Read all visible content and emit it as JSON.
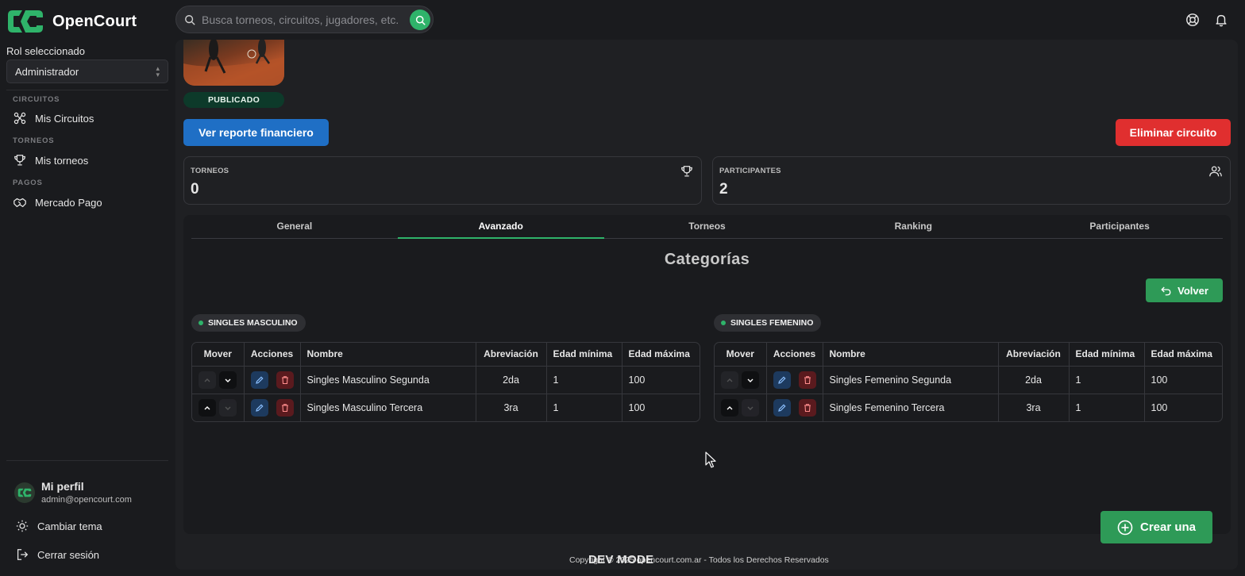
{
  "app": {
    "name": "OpenCourt"
  },
  "search": {
    "placeholder": "Busca torneos, circuitos, jugadores, etc."
  },
  "sidebar": {
    "rol_label": "Rol seleccionado",
    "rol_value": "Administrador",
    "sections": [
      {
        "title": "CIRCUITOS",
        "item": "Mis Circuitos",
        "icon": "circuit-icon"
      },
      {
        "title": "TORNEOS",
        "item": "Mis torneos",
        "icon": "trophy-icon"
      },
      {
        "title": "PAGOS",
        "item": "Mercado Pago",
        "icon": "handshake-icon"
      }
    ],
    "profile_name": "Mi perfil",
    "profile_email": "admin@opencourt.com",
    "theme_label": "Cambiar tema",
    "logout_label": "Cerrar sesión"
  },
  "circuit": {
    "status": "PUBLICADO",
    "report_button": "Ver reporte financiero",
    "delete_button": "Eliminar circuito"
  },
  "stats": [
    {
      "label": "TORNEOS",
      "value": "0",
      "icon": "trophy-icon"
    },
    {
      "label": "PARTICIPANTES",
      "value": "2",
      "icon": "users-icon"
    }
  ],
  "tabs": [
    {
      "label": "General",
      "active": false
    },
    {
      "label": "Avanzado",
      "active": true
    },
    {
      "label": "Torneos",
      "active": false
    },
    {
      "label": "Ranking",
      "active": false
    },
    {
      "label": "Participantes",
      "active": false
    }
  ],
  "panel": {
    "title": "Categorías",
    "back_button": "Volver"
  },
  "columns": [
    "Mover",
    "Acciones",
    "Nombre",
    "Abreviación",
    "Edad mínima",
    "Edad máxima"
  ],
  "groups": [
    {
      "title": "SINGLES MASCULINO",
      "rows": [
        {
          "nombre": "Singles Masculino Segunda",
          "abreviacion": "2da",
          "edad_min": "1",
          "edad_max": "100"
        },
        {
          "nombre": "Singles Masculino Tercera",
          "abreviacion": "3ra",
          "edad_min": "1",
          "edad_max": "100"
        }
      ]
    },
    {
      "title": "SINGLES FEMENINO",
      "rows": [
        {
          "nombre": "Singles Femenino Segunda",
          "abreviacion": "2da",
          "edad_min": "1",
          "edad_max": "100"
        },
        {
          "nombre": "Singles Femenino Tercera",
          "abreviacion": "3ra",
          "edad_min": "1",
          "edad_max": "100"
        }
      ]
    }
  ],
  "create_button": "Crear una",
  "footer": {
    "text": "Copyright © 2025 opencourt.com.ar - Todos los Derechos Reservados",
    "dev_mode": "DEV MODE"
  },
  "colors": {
    "accent": "#2fb36a",
    "primary_blue": "#1f6fc5",
    "danger": "#e02f2f",
    "success_btn": "#2e9a57"
  }
}
